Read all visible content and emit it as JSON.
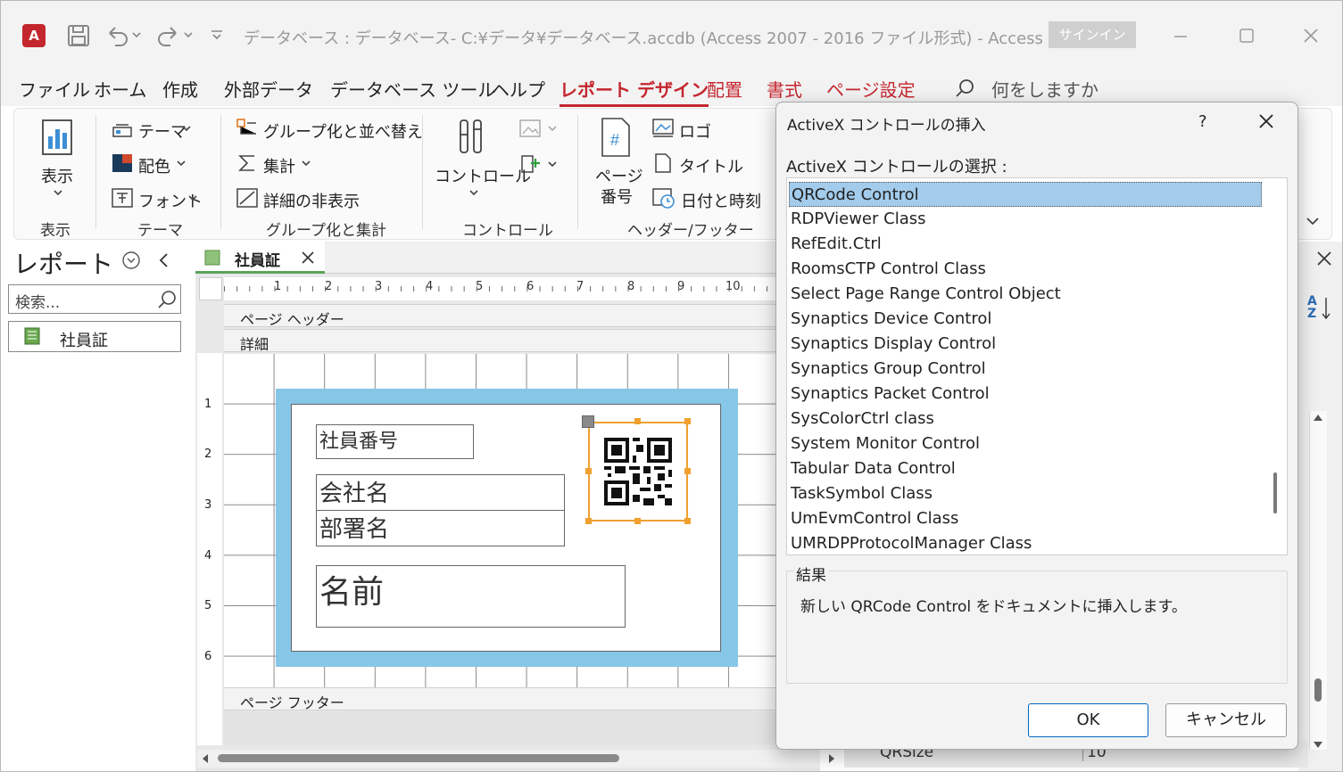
{
  "title_bar": {
    "text": "データベース : データベース- C:¥データ¥データベース.accdb (Access 2007 - 2016 ファイル形式)  -  Access",
    "signin": "サインイン",
    "app_icon": "A"
  },
  "menu": {
    "items": [
      "ファイル",
      "ホーム",
      "作成",
      "外部データ",
      "データベース ツール",
      "ヘルプ",
      "レポート デザイン",
      "配置",
      "書式",
      "ページ設定"
    ],
    "search_placeholder": "何をしますか"
  },
  "ribbon": {
    "view": {
      "label": "表示",
      "group": "表示"
    },
    "theme": {
      "themes": "テーマ",
      "colors": "配色",
      "fonts": "フォント",
      "group": "テーマ"
    },
    "grouping": {
      "group_sort": "グループ化と並べ替え",
      "totals": "集計",
      "hide_details": "詳細の非表示",
      "group": "グループ化と集計"
    },
    "controls": {
      "label": "コントロール",
      "group": "コントロール"
    },
    "header_footer": {
      "page_number_line1": "ページ",
      "page_number_line2": "番号",
      "logo": "ロゴ",
      "title": "タイトル",
      "date_time": "日付と時刻",
      "group": "ヘッダー/フッター"
    }
  },
  "nav": {
    "title": "レポート",
    "search_placeholder": "検索...",
    "items": [
      "社員証"
    ]
  },
  "design": {
    "tab": "社員証",
    "ruler": [
      "1",
      "2",
      "3",
      "4",
      "5",
      "6",
      "7",
      "8",
      "9",
      "10"
    ],
    "vruler": [
      "1",
      "2",
      "3",
      "4",
      "5",
      "6"
    ],
    "sections": {
      "page_header": "ページ ヘッダー",
      "detail": "詳細",
      "page_footer": "ページ フッター"
    },
    "labels": {
      "emp_no": "社員番号",
      "company": "会社名",
      "dept": "部署名",
      "name": "名前"
    }
  },
  "props": {
    "row_label": "QRSize",
    "row_value": "10",
    "sort_icon": "AZ"
  },
  "dialog": {
    "title": "ActiveX コントロールの挿入",
    "help": "?",
    "prompt": "ActiveX コントロールの選択 :",
    "items": [
      "QRCode Control",
      "RDPViewer Class",
      "RefEdit.Ctrl",
      "RoomsCTP Control Class",
      "Select Page Range Control Object",
      "Synaptics Device Control",
      "Synaptics Display Control",
      "Synaptics Group Control",
      "Synaptics Packet Control",
      "SysColorCtrl class",
      "System Monitor Control",
      "Tabular Data Control",
      "TaskSymbol Class",
      "UmEvmControl Class",
      "UMRDPProtocolManager  Class"
    ],
    "selected_index": 0,
    "result_label": "結果",
    "result_text": "新しい QRCode Control をドキュメントに挿入します。",
    "ok": "OK",
    "cancel": "キャンセル"
  },
  "colors": {
    "accent_red": "#c4262e",
    "selection": "#a3ccec",
    "card_blue": "#86c6e6",
    "handle_orange": "#f0a030"
  }
}
